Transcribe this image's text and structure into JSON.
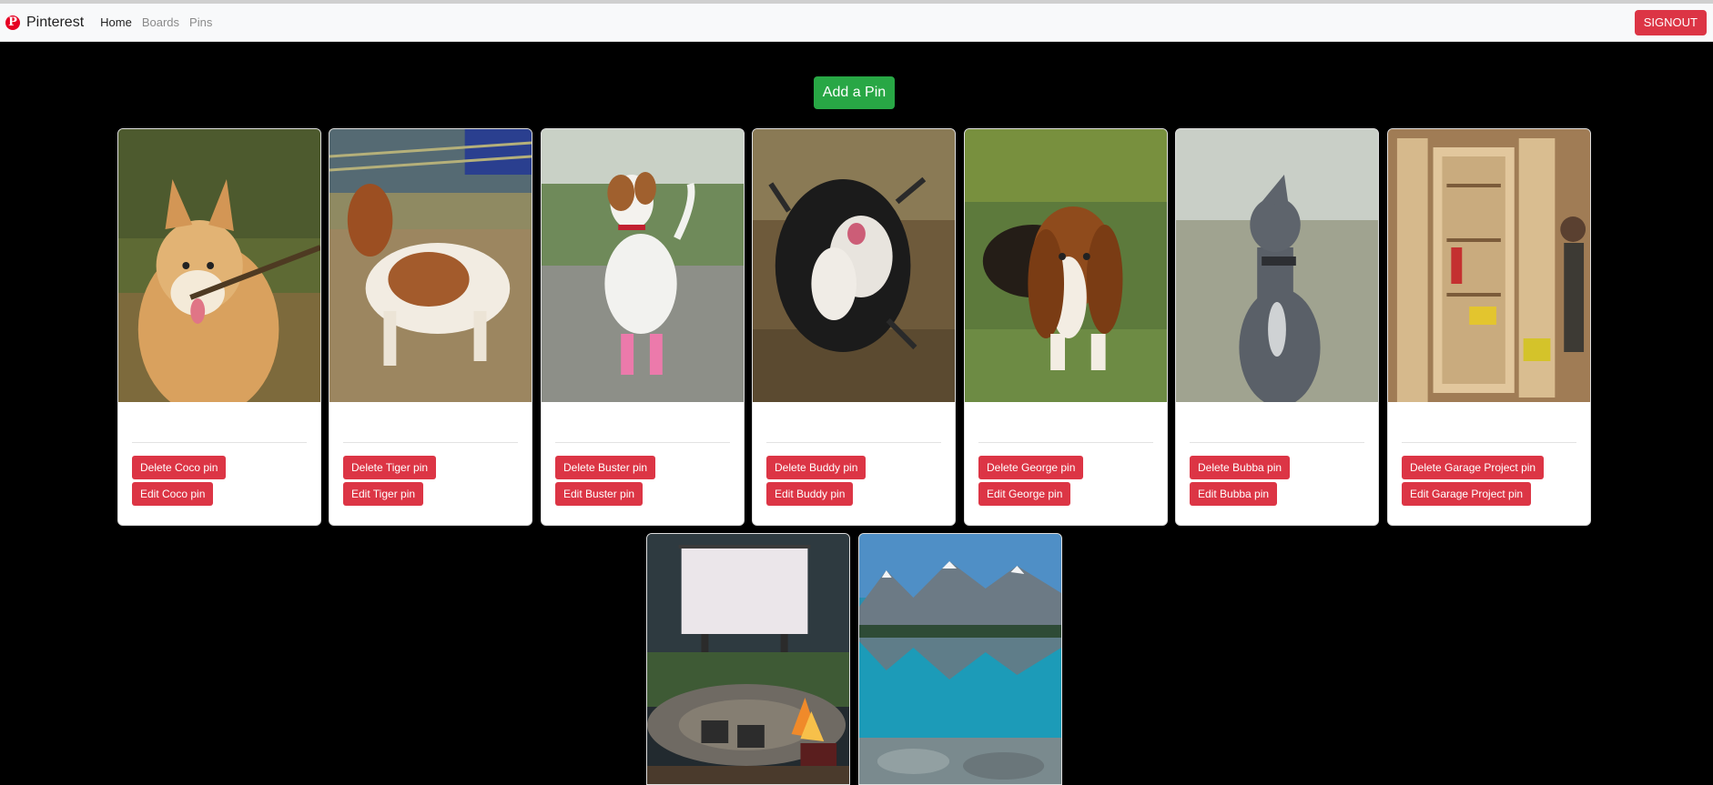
{
  "navbar": {
    "brand": "Pinterest",
    "brand_icon": "pinterest-logo-icon",
    "links": [
      {
        "label": "Home",
        "active": true
      },
      {
        "label": "Boards",
        "active": false
      },
      {
        "label": "Pins",
        "active": false
      }
    ],
    "signout_label": "SIGNOUT"
  },
  "main": {
    "add_pin_label": "Add a Pin"
  },
  "pins": [
    {
      "name": "Coco",
      "delete_label": "Delete Coco pin",
      "edit_label": "Edit Coco pin",
      "image": "corgi-holding-stick"
    },
    {
      "name": "Tiger",
      "delete_label": "Delete Tiger pin",
      "edit_label": "Edit Tiger pin",
      "image": "brown-white-dog-on-grass"
    },
    {
      "name": "Buster",
      "delete_label": "Delete Buster pin",
      "edit_label": "Edit Buster pin",
      "image": "terrier-in-pink-boots"
    },
    {
      "name": "Buddy",
      "delete_label": "Delete Buddy pin",
      "edit_label": "Edit Buddy pin",
      "image": "black-white-dog-shaking"
    },
    {
      "name": "George",
      "delete_label": "Delete George pin",
      "edit_label": "Edit George pin",
      "image": "basset-hound-on-grass"
    },
    {
      "name": "Bubba",
      "delete_label": "Delete Bubba pin",
      "edit_label": "Edit Bubba pin",
      "image": "grey-greyhound-in-field"
    },
    {
      "name": "Garage Project",
      "delete_label": "Delete Garage Project pin",
      "edit_label": "Edit Garage Project pin",
      "image": "garage-tool-cabinet"
    },
    {
      "name": "",
      "image": "outdoor-movie-screen-firepit"
    },
    {
      "name": "",
      "image": "mountain-lake-reflection"
    }
  ],
  "colors": {
    "danger": "#dc3545",
    "success": "#28a745",
    "background": "#000000",
    "navbar": "#f8f9fa"
  }
}
